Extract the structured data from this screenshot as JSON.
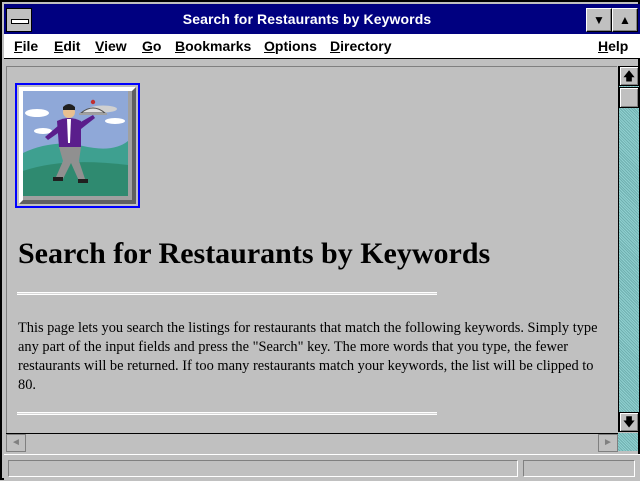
{
  "window": {
    "title": "Search for Restaurants by Keywords",
    "minimize_glyph": "▼",
    "maximize_glyph": "▲"
  },
  "menubar": {
    "items": [
      {
        "accel": "F",
        "rest": "ile"
      },
      {
        "accel": "E",
        "rest": "dit"
      },
      {
        "accel": "V",
        "rest": "iew"
      },
      {
        "accel": "G",
        "rest": "o"
      },
      {
        "accel": "B",
        "rest": "ookmarks"
      },
      {
        "accel": "O",
        "rest": "ptions"
      },
      {
        "accel": "D",
        "rest": "irectory"
      },
      {
        "accel": "H",
        "rest": "elp"
      }
    ]
  },
  "page": {
    "heading": "Search for Restaurants by Keywords",
    "body": "This page lets you search the listings for restaurants that match the following keywords. Simply type any part of the input fields and press the \"Search\" key. The more words that you type, the fewer restaurants will be returned. If too many restaurants match your keywords, the list will be clipped to 80.",
    "logo_icon": "waiter-serving-tray-image"
  },
  "scrollbar": {
    "up_glyph": "🡅",
    "down_glyph": "🡇",
    "left_glyph": "◄",
    "right_glyph": "►"
  },
  "colors": {
    "titlebar": "#000080",
    "window_bg": "#c0c0c0",
    "link_border": "#0000ff",
    "scroll_track": "#80c0c0"
  }
}
